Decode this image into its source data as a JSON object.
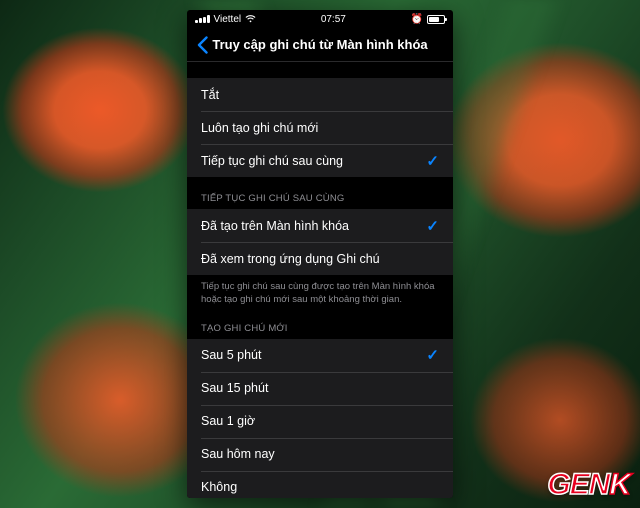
{
  "status": {
    "carrier": "Viettel",
    "time": "07:57"
  },
  "nav": {
    "title": "Truy cập ghi chú từ Màn hình khóa"
  },
  "group1": {
    "items": [
      {
        "label": "Tắt",
        "checked": false
      },
      {
        "label": "Luôn tạo ghi chú mới",
        "checked": false
      },
      {
        "label": "Tiếp tục ghi chú sau cùng",
        "checked": true
      }
    ]
  },
  "group2": {
    "header": "TIẾP TỤC GHI CHÚ SAU CÙNG",
    "items": [
      {
        "label": "Đã tạo trên Màn hình khóa",
        "checked": true
      },
      {
        "label": "Đã xem trong ứng dụng Ghi chú",
        "checked": false
      }
    ],
    "footer": "Tiếp tục ghi chú sau cùng được tạo trên Màn hình khóa hoặc tạo ghi chú mới sau một khoảng thời gian."
  },
  "group3": {
    "header": "TẠO GHI CHÚ MỚI",
    "items": [
      {
        "label": "Sau 5 phút",
        "checked": true
      },
      {
        "label": "Sau 15 phút",
        "checked": false
      },
      {
        "label": "Sau 1 giờ",
        "checked": false
      },
      {
        "label": "Sau hôm nay",
        "checked": false
      },
      {
        "label": "Không",
        "checked": false
      }
    ]
  },
  "watermark": {
    "main": "GEN",
    "suffix": "K"
  },
  "check_glyph": "✓"
}
